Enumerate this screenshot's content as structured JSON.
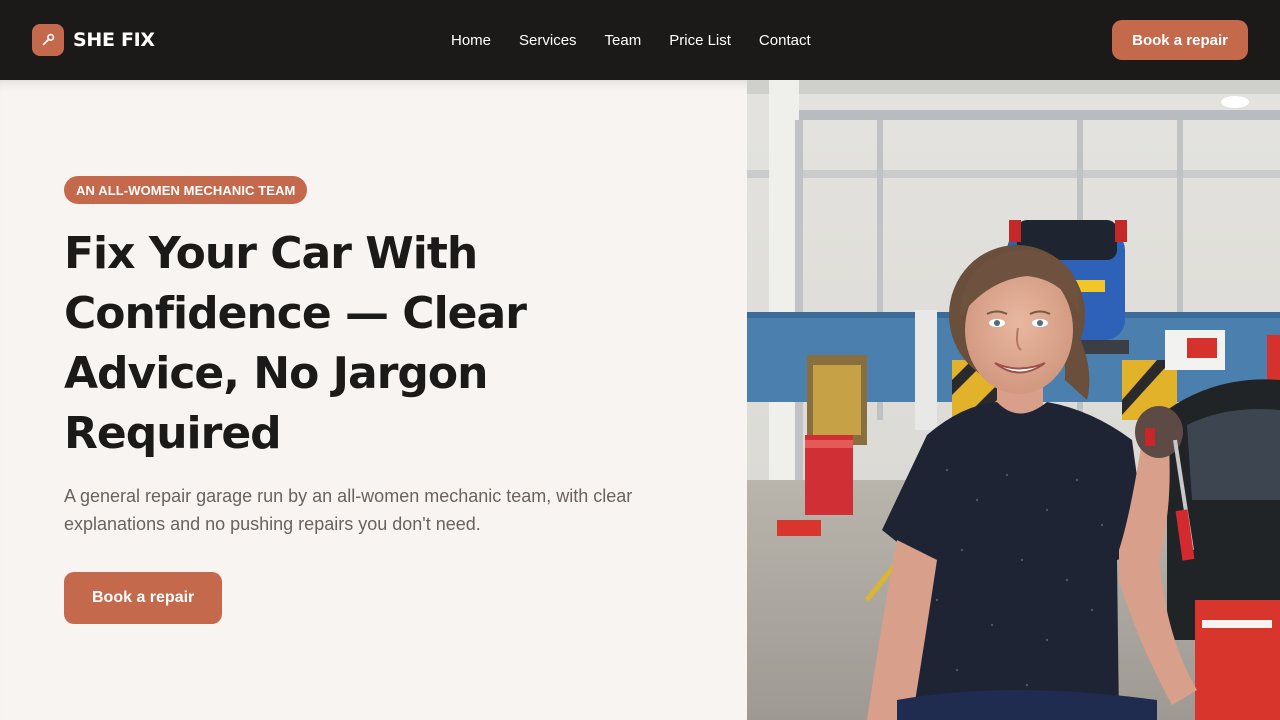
{
  "header": {
    "brand_name": "SHE FIX",
    "logo_icon": "wrench-icon",
    "nav": [
      "Home",
      "Services",
      "Team",
      "Price List",
      "Contact"
    ],
    "cta_label": "Book a repair"
  },
  "hero": {
    "badge": "AN ALL-WOMEN MECHANIC TEAM",
    "headline": "Fix Your Car With Confidence — Clear Advice, No Jargon Required",
    "subtext": "A general repair garage run by an all-women mechanic team, with clear explanations and no pushing repairs you don't need.",
    "cta_label": "Book a repair"
  },
  "colors": {
    "accent": "#c4694c",
    "header_bg": "#1c1a18",
    "page_bg": "#f8f4f1",
    "body_text": "#6b625c"
  }
}
